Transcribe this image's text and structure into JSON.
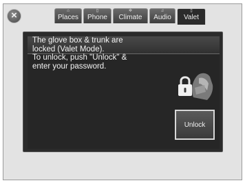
{
  "tabs": [
    {
      "label": "Places",
      "icon": "map-pin-icon",
      "glyph": "⌂"
    },
    {
      "label": "Phone",
      "icon": "phone-icon",
      "glyph": "▯"
    },
    {
      "label": "Climate",
      "icon": "fan-icon",
      "glyph": "✲"
    },
    {
      "label": "Audio",
      "icon": "music-note-icon",
      "glyph": "♫"
    },
    {
      "label": "Valet",
      "icon": "valet-icon",
      "glyph": "▯",
      "active": true
    }
  ],
  "close_glyph": "×",
  "message": "The glove box & trunk are\nlocked (Valet Mode).\nTo unlock, push \"Unlock\" &\nenter your password.",
  "unlock_label": "Unlock"
}
